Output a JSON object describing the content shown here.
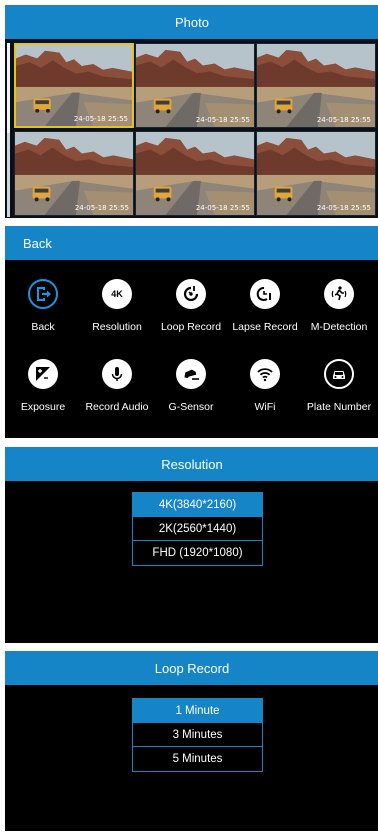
{
  "photo": {
    "title": "Photo",
    "thumbnails": [
      {
        "timestamp": "24-05-18 25:55",
        "selected": true
      },
      {
        "timestamp": "24-05-18 25:55",
        "selected": false
      },
      {
        "timestamp": "24-05-18 25:55",
        "selected": false
      },
      {
        "timestamp": "24-05-18 25:55",
        "selected": false
      },
      {
        "timestamp": "24-05-18 25:55",
        "selected": false
      },
      {
        "timestamp": "24-05-18 25:55",
        "selected": false
      }
    ]
  },
  "menu": {
    "title": "Back",
    "items": [
      {
        "label": "Back",
        "icon": "exit-icon"
      },
      {
        "label": "Resolution",
        "icon": "4k-icon",
        "icon_text": "4K"
      },
      {
        "label": "Loop Record",
        "icon": "loop-record-icon"
      },
      {
        "label": "Lapse Record",
        "icon": "lapse-record-icon"
      },
      {
        "label": "M-Detection",
        "icon": "motion-detection-icon"
      },
      {
        "label": "Exposure",
        "icon": "exposure-icon"
      },
      {
        "label": "Record Audio",
        "icon": "microphone-icon"
      },
      {
        "label": "G-Sensor",
        "icon": "g-sensor-icon"
      },
      {
        "label": "WiFi",
        "icon": "wifi-icon"
      },
      {
        "label": "Plate Number",
        "icon": "car-icon"
      }
    ]
  },
  "resolution": {
    "title": "Resolution",
    "options": [
      "4K(3840*2160)",
      "2K(2560*1440)",
      "FHD (1920*1080)"
    ],
    "selected": "4K(3840*2160)"
  },
  "loop_record": {
    "title": "Loop Record",
    "options": [
      "1 Minute",
      "3 Minutes",
      "5 Minutes"
    ],
    "selected": "1 Minute"
  },
  "colors": {
    "accent": "#1585c8",
    "selection_border": "#e6c21a",
    "background": "#000000"
  }
}
